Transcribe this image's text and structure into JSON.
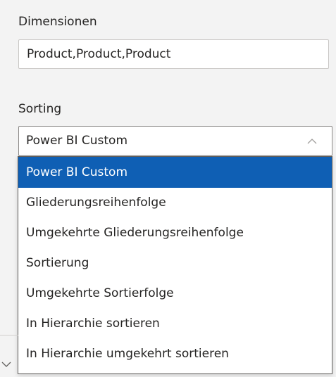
{
  "dimensions": {
    "label": "Dimensionen",
    "value": "Product,Product,Product"
  },
  "sorting": {
    "label": "Sorting",
    "selected": "Power BI Custom",
    "options": [
      "Power BI Custom",
      "Gliederungsreihenfolge",
      "Umgekehrte Gliederungsreihenfolge",
      "Sortierung",
      "Umgekehrte Sortierfolge",
      "In Hierarchie sortieren",
      "In Hierarchie umgekehrt sortieren"
    ],
    "selected_index": 0
  },
  "icons": {
    "dropdown": "chevron-up-icon",
    "collapsed_section": "chevron-down-icon"
  },
  "colors": {
    "selection": "#0f5fb4",
    "panel_bg": "#f3f3f3",
    "text": "#252423"
  }
}
